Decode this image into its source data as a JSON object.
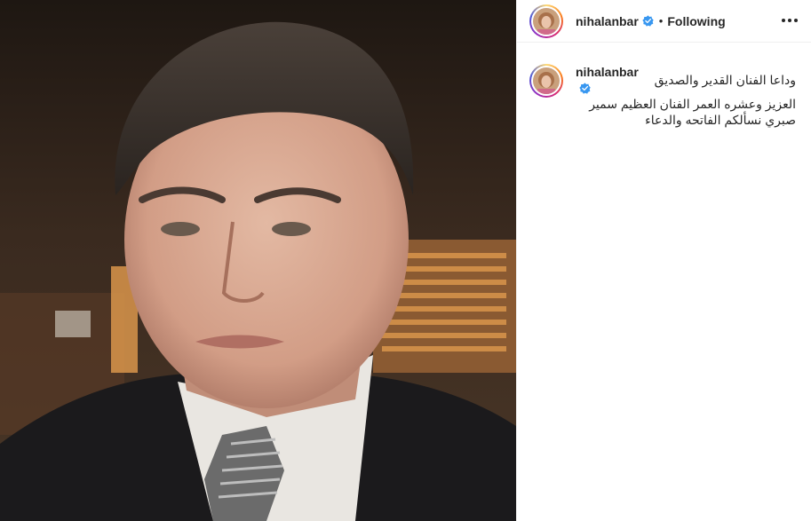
{
  "post": {
    "author": {
      "username": "nihalanbar",
      "verified": true,
      "avatar_icon": "profile-avatar"
    },
    "header": {
      "separator": "•",
      "follow_status": "Following",
      "more_icon": "more-options-icon"
    },
    "caption": {
      "line1": "وداعا الفنان القدير والصديق",
      "line2": "العزيز وعشره العمر الفنان العظيم سمير",
      "line3": "صبري نسألكم الفاتحه والدعاء"
    },
    "colors": {
      "verified_badge": "#3897f0",
      "story_ring": [
        "#feda75",
        "#fa7e1e",
        "#d62976",
        "#962fbf",
        "#4f5bd5"
      ],
      "divider": "#efefef"
    }
  }
}
